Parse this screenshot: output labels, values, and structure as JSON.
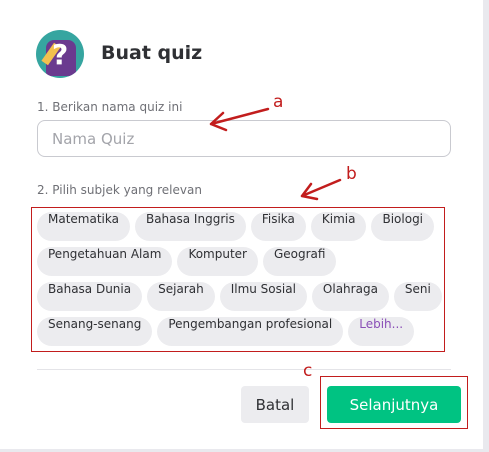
{
  "dialog": {
    "title": "Buat quiz",
    "name_label": "1. Berikan nama quiz ini",
    "name_input": {
      "value": "",
      "placeholder": "Nama Quiz"
    },
    "subjects_label": "2. Pilih subjek yang relevan",
    "subjects": [
      "Matematika",
      "Bahasa Inggris",
      "Fisika",
      "Kimia",
      "Biologi",
      "Pengetahuan Alam",
      "Komputer",
      "Geografi",
      "Bahasa Dunia",
      "Sejarah",
      "Ilmu Sosial",
      "Olahraga",
      "Seni",
      "Senang-senang",
      "Pengembangan profesional"
    ],
    "more_label": "Lebih...",
    "cancel_label": "Batal",
    "next_label": "Selanjutnya"
  },
  "annotations": {
    "a": "a",
    "b": "b",
    "c": "c"
  },
  "colors": {
    "accent_green": "#00c382",
    "annotation_red": "#c21d1d",
    "more_purple": "#8a4fb7",
    "chip_bg": "#ececef",
    "logo_teal": "#36a5a0",
    "logo_purple": "#6a3a8f"
  },
  "icons": {
    "logo": "quiz-logo-icon",
    "arrow": "annotation-arrow-icon"
  }
}
